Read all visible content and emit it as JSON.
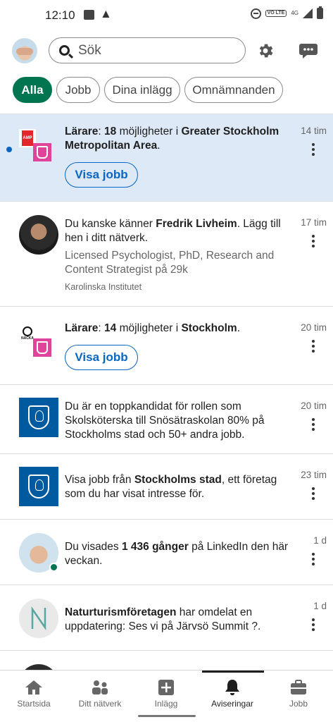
{
  "status_bar": {
    "time": "12:10",
    "network": "4G",
    "volte": "VO LTE",
    "icons": [
      "image-icon",
      "warning-icon",
      "dnd-icon",
      "signal-icon",
      "battery-icon"
    ]
  },
  "header": {
    "search_placeholder": "Sök",
    "icons": [
      "avatar",
      "search-icon",
      "gear-icon",
      "messaging-icon"
    ]
  },
  "filters": [
    {
      "label": "Alla",
      "active": true
    },
    {
      "label": "Jobb",
      "active": false
    },
    {
      "label": "Dina inlägg",
      "active": false
    },
    {
      "label": "Omnämnanden",
      "active": false
    }
  ],
  "notifications": [
    {
      "unread": true,
      "line1_bold_a": "Lärare",
      "line1_plain_a": ": ",
      "line1_bold_b": "18",
      "line1_plain_b": " möjligheter i ",
      "line1_bold_c": "Greater Stockholm Metropolitan Area",
      "line1_plain_c": ".",
      "button": "Visa jobb",
      "time": "14 tim",
      "logo_a_text": "AMP"
    },
    {
      "unread": false,
      "text_plain_a": "Du kanske känner ",
      "text_bold": "Fredrik Livheim",
      "text_plain_b": ". Lägg till hen i ditt nätverk.",
      "subtitle": "Licensed Psychologist, PhD, Research and Content Strategist på 29k",
      "company": "Karolinska Institutet",
      "time": "17 tim"
    },
    {
      "unread": false,
      "line1_bold_a": "Lärare",
      "line1_plain_a": ": ",
      "line1_bold_b": "14",
      "line1_plain_b": " möjligheter i ",
      "line1_bold_c": "Stockholm",
      "line1_plain_c": ".",
      "button": "Visa jobb",
      "time": "20 tim",
      "logo_a_text": "NACKA"
    },
    {
      "unread": false,
      "text": "Du är en toppkandidat för rollen som Skolsköterska till Snösätraskolan 80% på Stockholms stad och 50+ andra jobb.",
      "time": "20 tim"
    },
    {
      "unread": false,
      "text_plain_a": "Visa jobb från ",
      "text_bold": "Stockholms stad",
      "text_plain_b": ", ett företag som du har visat intresse för.",
      "time": "23 tim"
    },
    {
      "unread": false,
      "text_plain_a": "Du visades ",
      "text_bold": "1 436 gånger",
      "text_plain_b": " på LinkedIn den här veckan.",
      "time": "1 d"
    },
    {
      "unread": false,
      "text_bold": "Naturturismföretagen",
      "text_plain_b": " har omdelat en uppdatering: Ses vi på Järvsö Summit ?.",
      "time": "1 d"
    }
  ],
  "bottom_nav": [
    {
      "label": "Startsida",
      "icon": "home-icon",
      "active": false
    },
    {
      "label": "Ditt nätverk",
      "icon": "network-icon",
      "active": false
    },
    {
      "label": "Inlägg",
      "icon": "post-icon",
      "active": false
    },
    {
      "label": "Aviseringar",
      "icon": "bell-icon",
      "active": true
    },
    {
      "label": "Jobb",
      "icon": "briefcase-icon",
      "active": false
    }
  ],
  "colors": {
    "accent_green": "#01754f",
    "link_blue": "#0a66c2",
    "unread_bg": "#dde9f7",
    "stockholm_blue": "#005aa0"
  }
}
